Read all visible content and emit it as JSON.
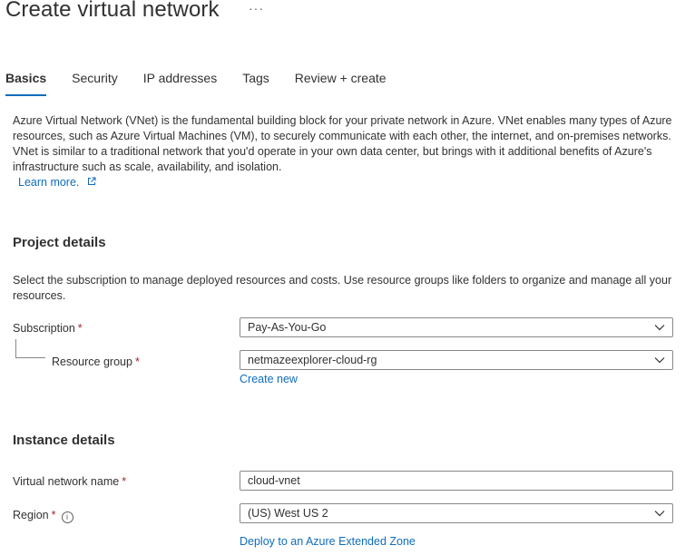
{
  "header": {
    "title": "Create virtual network",
    "more_icon": "more-horizontal-icon",
    "more_glyph": "···"
  },
  "tabs": [
    {
      "label": "Basics",
      "active": true
    },
    {
      "label": "Security",
      "active": false
    },
    {
      "label": "IP addresses",
      "active": false
    },
    {
      "label": "Tags",
      "active": false
    },
    {
      "label": "Review + create",
      "active": false
    }
  ],
  "intro": {
    "text": "Azure Virtual Network (VNet) is the fundamental building block for your private network in Azure. VNet enables many types of Azure resources, such as Azure Virtual Machines (VM), to securely communicate with each other, the internet, and on-premises networks. VNet is similar to a traditional network that you'd operate in your own data center, but brings with it additional benefits of Azure's infrastructure such as scale, availability, and isolation.",
    "learn_more": "Learn more.",
    "learn_more_icon": "external-link-icon"
  },
  "project_details": {
    "heading": "Project details",
    "description": "Select the subscription to manage deployed resources and costs. Use resource groups like folders to organize and manage all your resources.",
    "subscription_label": "Subscription",
    "subscription_value": "Pay-As-You-Go",
    "resource_group_label": "Resource group",
    "resource_group_value": "netmazeexplorer-cloud-rg",
    "create_new": "Create new"
  },
  "instance_details": {
    "heading": "Instance details",
    "vnet_name_label": "Virtual network name",
    "vnet_name_value": "cloud-vnet",
    "region_label": "Region",
    "region_value": "(US) West US 2",
    "region_info_icon": "info-icon",
    "extended_zone_link": "Deploy to an Azure Extended Zone"
  },
  "required_marker": "*",
  "colors": {
    "accent": "#0f6cbd",
    "required": "#a4262c",
    "text": "#323130",
    "border": "#8a8886"
  }
}
